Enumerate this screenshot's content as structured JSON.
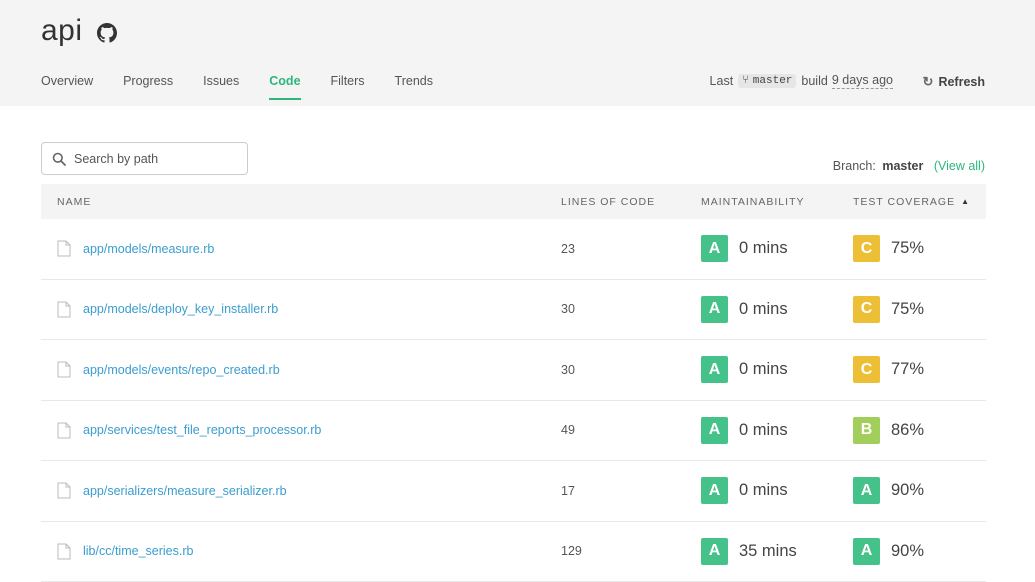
{
  "header": {
    "title": "api",
    "tabs": [
      {
        "label": "Overview",
        "active": false
      },
      {
        "label": "Progress",
        "active": false
      },
      {
        "label": "Issues",
        "active": false
      },
      {
        "label": "Code",
        "active": true
      },
      {
        "label": "Filters",
        "active": false
      },
      {
        "label": "Trends",
        "active": false
      }
    ],
    "build": {
      "last": "Last",
      "branch": "master",
      "build": "build",
      "ago": "9 days ago"
    },
    "refresh_label": "Refresh"
  },
  "search": {
    "placeholder": "Search by path",
    "value": ""
  },
  "branch_info": {
    "label": "Branch:",
    "name": "master",
    "view_all": "(View all)"
  },
  "table": {
    "columns": [
      "NAME",
      "LINES OF CODE",
      "MAINTAINABILITY",
      "TEST COVERAGE"
    ],
    "sort_column": "TEST COVERAGE",
    "rows": [
      {
        "path": "app/models/measure.rb",
        "loc": "23",
        "maint_grade": "A",
        "maint_value": "0 mins",
        "cov_grade": "C",
        "cov_value": "75%"
      },
      {
        "path": "app/models/deploy_key_installer.rb",
        "loc": "30",
        "maint_grade": "A",
        "maint_value": "0 mins",
        "cov_grade": "C",
        "cov_value": "75%"
      },
      {
        "path": "app/models/events/repo_created.rb",
        "loc": "30",
        "maint_grade": "A",
        "maint_value": "0 mins",
        "cov_grade": "C",
        "cov_value": "77%"
      },
      {
        "path": "app/services/test_file_reports_processor.rb",
        "loc": "49",
        "maint_grade": "A",
        "maint_value": "0 mins",
        "cov_grade": "B",
        "cov_value": "86%"
      },
      {
        "path": "app/serializers/measure_serializer.rb",
        "loc": "17",
        "maint_grade": "A",
        "maint_value": "0 mins",
        "cov_grade": "A",
        "cov_value": "90%"
      },
      {
        "path": "lib/cc/time_series.rb",
        "loc": "129",
        "maint_grade": "A",
        "maint_value": "35 mins",
        "cov_grade": "A",
        "cov_value": "90%"
      }
    ]
  },
  "grade_colors": {
    "A": "#45c28a",
    "B": "#a2cf5c",
    "C": "#ecbf37"
  },
  "accent": "#2db67c",
  "link_color": "#3a9dd0"
}
